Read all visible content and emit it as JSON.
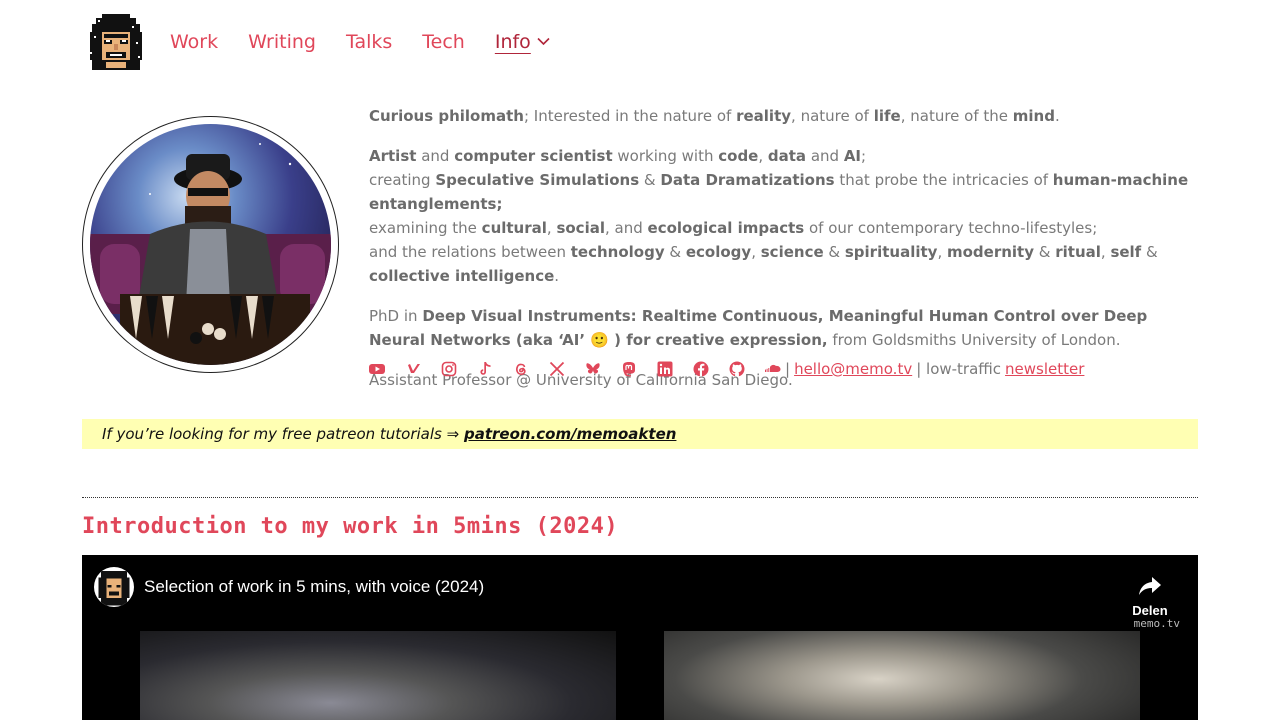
{
  "nav": {
    "items": [
      {
        "label": "Work"
      },
      {
        "label": "Writing"
      },
      {
        "label": "Talks"
      },
      {
        "label": "Tech"
      },
      {
        "label": "Info"
      }
    ]
  },
  "bio": {
    "p1": {
      "t1": "Curious philomath",
      "t2": "; Interested in the nature of ",
      "t3": "reality",
      "t4": ", nature of ",
      "t5": "life",
      "t6": ", nature of the ",
      "t7": "mind",
      "t8": "."
    },
    "p2": {
      "l1": {
        "a": "Artist",
        "b": " and ",
        "c": "computer scientist",
        "d": " working with ",
        "e": "code",
        "f": ", ",
        "g": "data",
        "h": " and ",
        "i": "AI",
        "j": ";"
      },
      "l2": {
        "a": "creating ",
        "b": "Speculative Simulations",
        "c": " & ",
        "d": "Data Dramatizations",
        "e": " that probe the intricacies of ",
        "f": "human-machine entanglements;"
      },
      "l3": {
        "a": "examining the ",
        "b": "cultural",
        "c": ", ",
        "d": "social",
        "e": ", and ",
        "f": "ecological impacts",
        "g": " of our contemporary techno-lifestyles;"
      },
      "l4": {
        "a": "and the relations between ",
        "b": "technology",
        "c": " & ",
        "d": "ecology",
        "e": ", ",
        "f": "science",
        "g": " & ",
        "h": "spirituality",
        "i": ", ",
        "j": "modernity",
        "k": " & ",
        "l": "ritual",
        "m": ", ",
        "n": "self",
        "o": " & ",
        "p": "collective intelligence",
        "q": "."
      }
    },
    "p3": {
      "a": "PhD in ",
      "b": "Deep Visual Instruments: Realtime Continuous, Meaningful Human Control over Deep Neural Networks (aka ‘AI’ 🙂 ) for creative expression,",
      "c": " from Goldsmiths University of London."
    },
    "p4": "Assistant Professor @ University of California San Diego."
  },
  "social": {
    "icons": [
      "youtube-icon",
      "vimeo-icon",
      "instagram-icon",
      "tiktok-icon",
      "threads-icon",
      "x-icon",
      "bluesky-icon",
      "mastodon-icon",
      "linkedin-icon",
      "facebook-icon",
      "github-icon",
      "soundcloud-icon"
    ],
    "sep1": "|",
    "email": "hello@memo.tv",
    "sep2": "| low-traffic",
    "newsletter": "newsletter",
    "accent": "#e0475a"
  },
  "banner": {
    "text": "If you’re looking for my free patreon tutorials ⇒",
    "link": "patreon.com/memoakten",
    "bg": "#ffffb3"
  },
  "section": {
    "title": "Introduction to my work in 5mins (2024)"
  },
  "video": {
    "title": "Selection of work in 5 mins, with voice (2024)",
    "share_label": "Delen",
    "watermark": "memo.tv"
  }
}
